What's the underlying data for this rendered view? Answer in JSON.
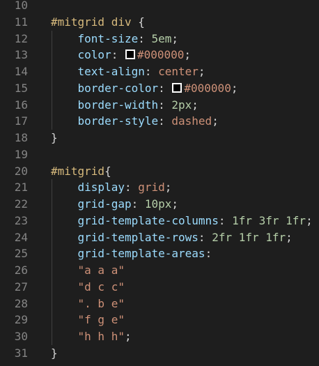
{
  "editor": {
    "colors": {
      "background": "#1e1e1e",
      "selector": "#d7ba7d",
      "property": "#9cdcfe",
      "string": "#ce9178",
      "number": "#b5cea8",
      "punctuation": "#d4d4d4",
      "line_number": "#858585"
    },
    "lines": [
      {
        "n": "10",
        "guide": false,
        "tokens": []
      },
      {
        "n": "11",
        "guide": false,
        "tokens": [
          {
            "t": "#mitgrid div ",
            "c": "sel"
          },
          {
            "t": "{",
            "c": "brace"
          }
        ]
      },
      {
        "n": "12",
        "guide": true,
        "tokens": [
          {
            "t": "    "
          },
          {
            "t": "font-size",
            "c": "prop"
          },
          {
            "t": ": ",
            "c": "punc"
          },
          {
            "t": "5em",
            "c": "num"
          },
          {
            "t": ";",
            "c": "punc"
          }
        ]
      },
      {
        "n": "13",
        "guide": true,
        "tokens": [
          {
            "t": "    "
          },
          {
            "t": "color",
            "c": "prop"
          },
          {
            "t": ": ",
            "c": "punc"
          },
          {
            "swatch": "#000000"
          },
          {
            "t": "#000000",
            "c": "val"
          },
          {
            "t": ";",
            "c": "punc"
          }
        ]
      },
      {
        "n": "14",
        "guide": true,
        "tokens": [
          {
            "t": "    "
          },
          {
            "t": "text-align",
            "c": "prop"
          },
          {
            "t": ": ",
            "c": "punc"
          },
          {
            "t": "center",
            "c": "val"
          },
          {
            "t": ";",
            "c": "punc"
          }
        ]
      },
      {
        "n": "15",
        "guide": true,
        "tokens": [
          {
            "t": "    "
          },
          {
            "t": "border-color",
            "c": "prop"
          },
          {
            "t": ": ",
            "c": "punc"
          },
          {
            "swatch": "#000000"
          },
          {
            "t": "#000000",
            "c": "val"
          },
          {
            "t": ";",
            "c": "punc"
          }
        ]
      },
      {
        "n": "16",
        "guide": true,
        "tokens": [
          {
            "t": "    "
          },
          {
            "t": "border-width",
            "c": "prop"
          },
          {
            "t": ": ",
            "c": "punc"
          },
          {
            "t": "2px",
            "c": "num"
          },
          {
            "t": ";",
            "c": "punc"
          }
        ]
      },
      {
        "n": "17",
        "guide": true,
        "tokens": [
          {
            "t": "    "
          },
          {
            "t": "border-style",
            "c": "prop"
          },
          {
            "t": ": ",
            "c": "punc"
          },
          {
            "t": "dashed",
            "c": "val"
          },
          {
            "t": ";",
            "c": "punc"
          }
        ]
      },
      {
        "n": "18",
        "guide": false,
        "tokens": [
          {
            "t": "}",
            "c": "brace"
          }
        ]
      },
      {
        "n": "19",
        "guide": false,
        "tokens": []
      },
      {
        "n": "20",
        "guide": false,
        "tokens": [
          {
            "t": "#mitgrid",
            "c": "sel"
          },
          {
            "t": "{",
            "c": "brace"
          }
        ]
      },
      {
        "n": "21",
        "guide": true,
        "tokens": [
          {
            "t": "    "
          },
          {
            "t": "display",
            "c": "prop"
          },
          {
            "t": ": ",
            "c": "punc"
          },
          {
            "t": "grid",
            "c": "val"
          },
          {
            "t": ";",
            "c": "punc"
          }
        ]
      },
      {
        "n": "22",
        "guide": true,
        "tokens": [
          {
            "t": "    "
          },
          {
            "t": "grid-gap",
            "c": "prop"
          },
          {
            "t": ": ",
            "c": "punc"
          },
          {
            "t": "10px",
            "c": "num"
          },
          {
            "t": ";",
            "c": "punc"
          }
        ]
      },
      {
        "n": "23",
        "guide": true,
        "tokens": [
          {
            "t": "    "
          },
          {
            "t": "grid-template-columns",
            "c": "prop"
          },
          {
            "t": ": ",
            "c": "punc"
          },
          {
            "t": "1fr 3fr 1fr",
            "c": "num"
          },
          {
            "t": ";",
            "c": "punc"
          }
        ]
      },
      {
        "n": "24",
        "guide": true,
        "tokens": [
          {
            "t": "    "
          },
          {
            "t": "grid-template-rows",
            "c": "prop"
          },
          {
            "t": ": ",
            "c": "punc"
          },
          {
            "t": "2fr 1fr 1fr",
            "c": "num"
          },
          {
            "t": ";",
            "c": "punc"
          }
        ]
      },
      {
        "n": "25",
        "guide": true,
        "tokens": [
          {
            "t": "    "
          },
          {
            "t": "grid-template-areas",
            "c": "prop"
          },
          {
            "t": ":",
            "c": "punc"
          }
        ]
      },
      {
        "n": "26",
        "guide": true,
        "tokens": [
          {
            "t": "    "
          },
          {
            "t": "\"a a a\"",
            "c": "val"
          }
        ]
      },
      {
        "n": "27",
        "guide": true,
        "tokens": [
          {
            "t": "    "
          },
          {
            "t": "\"d c c\"",
            "c": "val"
          }
        ]
      },
      {
        "n": "28",
        "guide": true,
        "tokens": [
          {
            "t": "    "
          },
          {
            "t": "\". b e\"",
            "c": "val"
          }
        ]
      },
      {
        "n": "29",
        "guide": true,
        "tokens": [
          {
            "t": "    "
          },
          {
            "t": "\"f g e\"",
            "c": "val"
          }
        ]
      },
      {
        "n": "30",
        "guide": true,
        "tokens": [
          {
            "t": "    "
          },
          {
            "t": "\"h h h\"",
            "c": "val"
          },
          {
            "t": ";",
            "c": "punc"
          }
        ]
      },
      {
        "n": "31",
        "guide": false,
        "tokens": [
          {
            "t": "}",
            "c": "brace"
          }
        ]
      }
    ]
  }
}
